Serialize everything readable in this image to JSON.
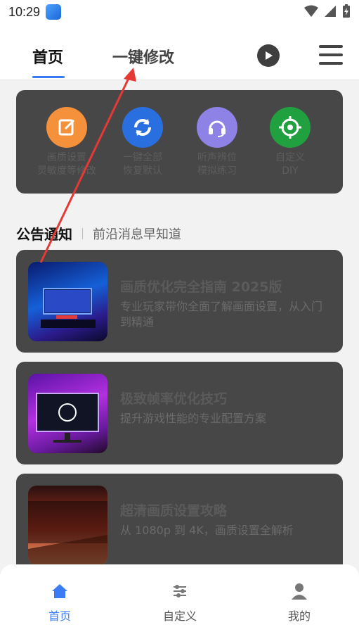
{
  "status_bar": {
    "time": "10:29"
  },
  "top_nav": {
    "tab_home": "首页",
    "tab_onekey": "一键修改"
  },
  "quick_actions": [
    {
      "label1": "画质设置",
      "label2": "灵敏度等修改",
      "icon": "edit-icon",
      "color": "#f5903b"
    },
    {
      "label1": "一键全部",
      "label2": "恢复默认",
      "icon": "refresh-icon",
      "color": "#2a6fe0"
    },
    {
      "label1": "听声辨位",
      "label2": "模拟练习",
      "icon": "headset-icon",
      "color": "#8e82e6"
    },
    {
      "label1": "自定义",
      "label2": "DIY",
      "icon": "target-icon",
      "color": "#21a040"
    }
  ],
  "announcements": {
    "title": "公告通知",
    "subtitle": "前沿消息早知道"
  },
  "articles": [
    {
      "title": "画质优化完全指南 2025版",
      "desc": "专业玩家带你全面了解画面设置，从入门到精通"
    },
    {
      "title": "极致帧率优化技巧",
      "desc": "提升游戏性能的专业配置方案"
    },
    {
      "title": "超清画质设置攻略",
      "desc": "从 1080p 到 4K，画质设置全解析"
    }
  ],
  "bottom_nav": {
    "home": "首页",
    "custom": "自定义",
    "mine": "我的"
  },
  "colors": {
    "accent": "#3b7cf5",
    "annotation": "#e53935"
  }
}
